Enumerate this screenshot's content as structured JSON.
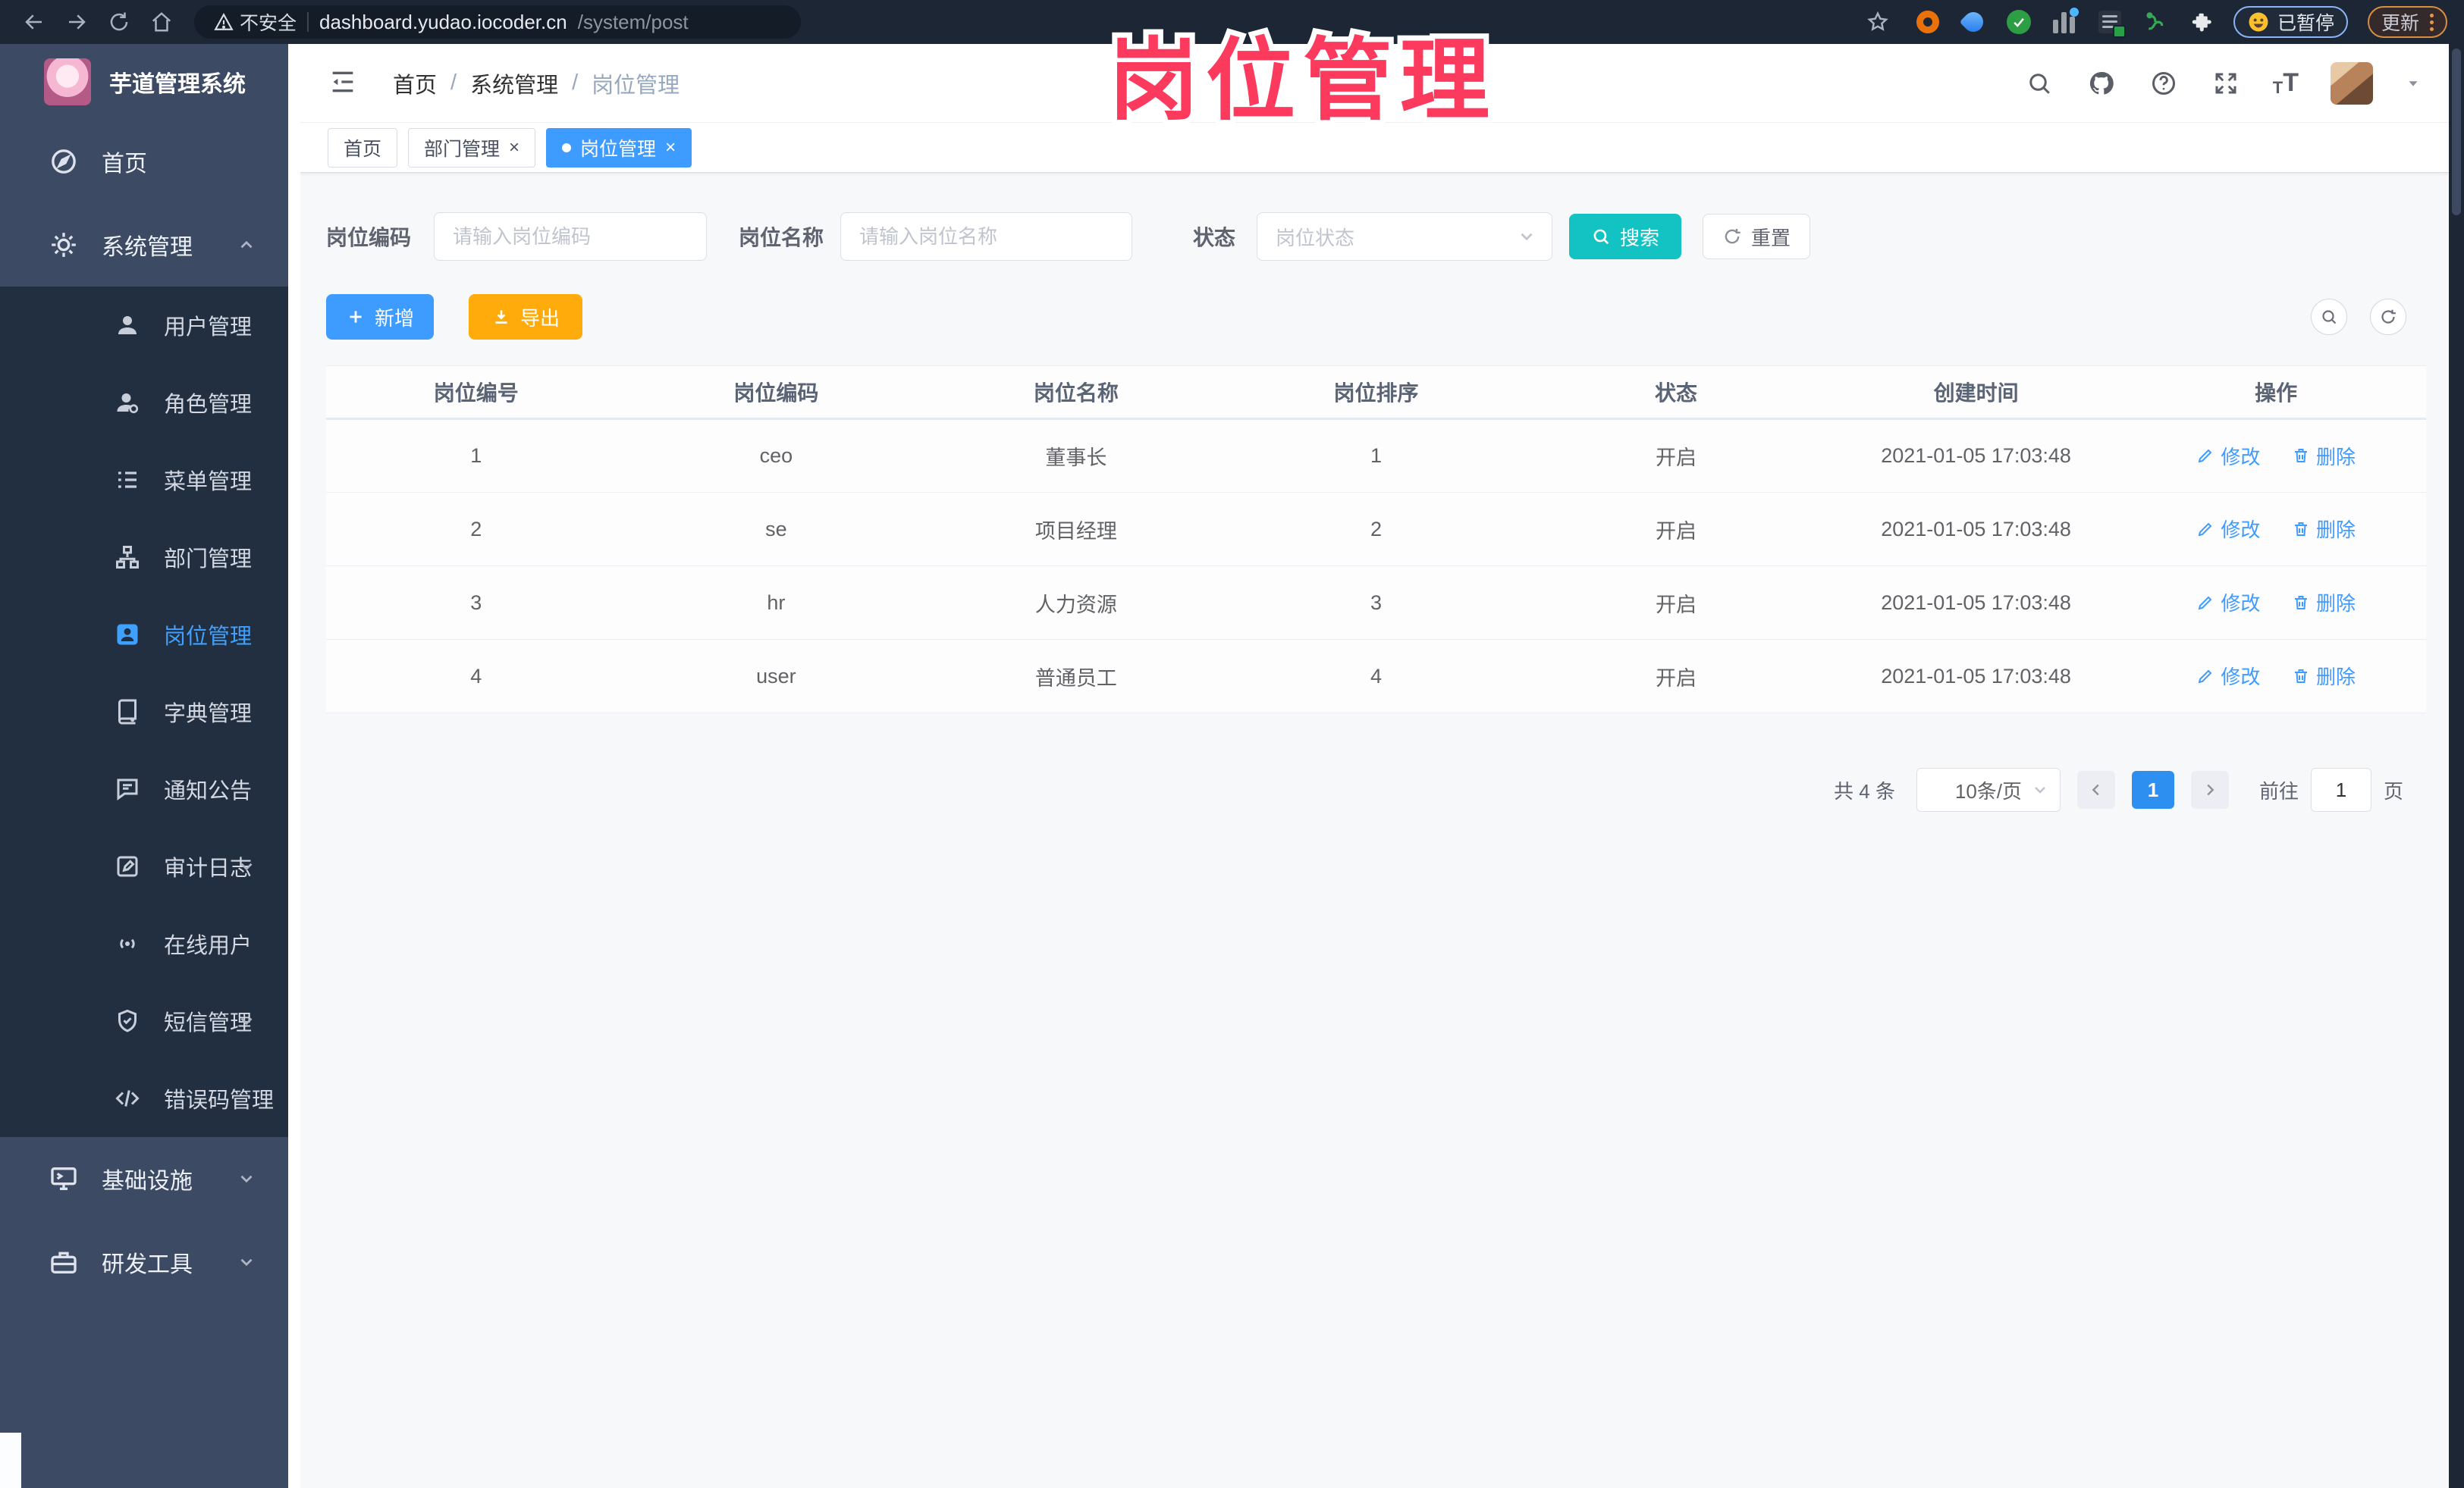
{
  "browser": {
    "security_label": "不安全",
    "url_host": "dashboard.yudao.iocoder.cn",
    "url_path": "/system/post",
    "paused_badge": "已暂停",
    "update_button": "更新"
  },
  "watermark": "岗位管理",
  "sidebar": {
    "app_title": "芋道管理系统",
    "items": [
      {
        "label": "首页"
      },
      {
        "label": "系统管理"
      },
      {
        "label": "用户管理"
      },
      {
        "label": "角色管理"
      },
      {
        "label": "菜单管理"
      },
      {
        "label": "部门管理"
      },
      {
        "label": "岗位管理"
      },
      {
        "label": "字典管理"
      },
      {
        "label": "通知公告"
      },
      {
        "label": "审计日志"
      },
      {
        "label": "在线用户"
      },
      {
        "label": "短信管理"
      },
      {
        "label": "错误码管理"
      },
      {
        "label": "基础设施"
      },
      {
        "label": "研发工具"
      }
    ]
  },
  "header": {
    "breadcrumb": {
      "home": "首页",
      "system": "系统管理",
      "current": "岗位管理",
      "separator": "/"
    },
    "tabs": [
      {
        "label": "首页"
      },
      {
        "label": "部门管理"
      },
      {
        "label": "岗位管理"
      }
    ]
  },
  "filters": {
    "post_code_label": "岗位编码",
    "post_code_placeholder": "请输入岗位编码",
    "post_name_label": "岗位名称",
    "post_name_placeholder": "请输入岗位名称",
    "status_label": "状态",
    "status_placeholder": "岗位状态",
    "search_label": "搜索",
    "reset_label": "重置"
  },
  "toolbar": {
    "add_label": "新增",
    "export_label": "导出"
  },
  "table": {
    "columns": [
      "岗位编号",
      "岗位编码",
      "岗位名称",
      "岗位排序",
      "状态",
      "创建时间",
      "操作"
    ],
    "edit_label": "修改",
    "delete_label": "删除",
    "rows": [
      {
        "id": "1",
        "code": "ceo",
        "name": "董事长",
        "sort": "1",
        "status": "开启",
        "created": "2021-01-05 17:03:48"
      },
      {
        "id": "2",
        "code": "se",
        "name": "项目经理",
        "sort": "2",
        "status": "开启",
        "created": "2021-01-05 17:03:48"
      },
      {
        "id": "3",
        "code": "hr",
        "name": "人力资源",
        "sort": "3",
        "status": "开启",
        "created": "2021-01-05 17:03:48"
      },
      {
        "id": "4",
        "code": "user",
        "name": "普通员工",
        "sort": "4",
        "status": "开启",
        "created": "2021-01-05 17:03:48"
      }
    ]
  },
  "pagination": {
    "total_text": "共 4 条",
    "page_size": "10条/页",
    "current_page": "1",
    "goto_label": "前往",
    "goto_value": "1",
    "page_unit": "页"
  },
  "colors": {
    "accent_blue": "#3e9bff",
    "search_teal": "#13c2c2",
    "export_amber": "#ffab0c",
    "watermark_pink": "#fb3a5e",
    "sidebar_bg": "#3c4a63",
    "submenu_bg": "#212f40",
    "browser_bar_bg": "#1d2634",
    "active_page_blue": "#2d8ff0"
  }
}
